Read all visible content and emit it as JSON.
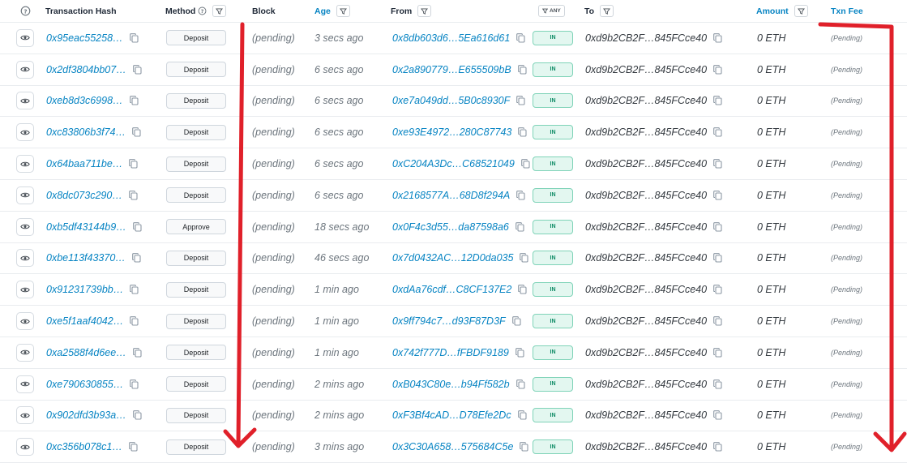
{
  "header": {
    "transaction_hash": "Transaction Hash",
    "method": "Method",
    "block": "Block",
    "age": "Age",
    "from": "From",
    "any": "ANY",
    "to": "To",
    "amount": "Amount",
    "txn_fee": "Txn Fee"
  },
  "rows": [
    {
      "hash": "0x95eac55258…",
      "method": "Deposit",
      "block": "(pending)",
      "age": "3 secs ago",
      "from": "0x8db603d6…5Ea616d61",
      "direction": "IN",
      "to": "0xd9b2CB2F…845FCce40",
      "amount": "0 ETH",
      "fee": "(Pending)"
    },
    {
      "hash": "0x2df3804bb07…",
      "method": "Deposit",
      "block": "(pending)",
      "age": "6 secs ago",
      "from": "0x2a890779…E655509bB",
      "direction": "IN",
      "to": "0xd9b2CB2F…845FCce40",
      "amount": "0 ETH",
      "fee": "(Pending)"
    },
    {
      "hash": "0xeb8d3c6998…",
      "method": "Deposit",
      "block": "(pending)",
      "age": "6 secs ago",
      "from": "0xe7a049dd…5B0c8930F",
      "direction": "IN",
      "to": "0xd9b2CB2F…845FCce40",
      "amount": "0 ETH",
      "fee": "(Pending)"
    },
    {
      "hash": "0xc83806b3f74…",
      "method": "Deposit",
      "block": "(pending)",
      "age": "6 secs ago",
      "from": "0xe93E4972…280C87743",
      "direction": "IN",
      "to": "0xd9b2CB2F…845FCce40",
      "amount": "0 ETH",
      "fee": "(Pending)"
    },
    {
      "hash": "0x64baa711be…",
      "method": "Deposit",
      "block": "(pending)",
      "age": "6 secs ago",
      "from": "0xC204A3Dc…C68521049",
      "direction": "IN",
      "to": "0xd9b2CB2F…845FCce40",
      "amount": "0 ETH",
      "fee": "(Pending)"
    },
    {
      "hash": "0x8dc073c290…",
      "method": "Deposit",
      "block": "(pending)",
      "age": "6 secs ago",
      "from": "0x2168577A…68D8f294A",
      "direction": "IN",
      "to": "0xd9b2CB2F…845FCce40",
      "amount": "0 ETH",
      "fee": "(Pending)"
    },
    {
      "hash": "0xb5df43144b9…",
      "method": "Approve",
      "block": "(pending)",
      "age": "18 secs ago",
      "from": "0x0F4c3d55…da87598a6",
      "direction": "IN",
      "to": "0xd9b2CB2F…845FCce40",
      "amount": "0 ETH",
      "fee": "(Pending)"
    },
    {
      "hash": "0xbe113f43370…",
      "method": "Deposit",
      "block": "(pending)",
      "age": "46 secs ago",
      "from": "0x7d0432AC…12D0da035",
      "direction": "IN",
      "to": "0xd9b2CB2F…845FCce40",
      "amount": "0 ETH",
      "fee": "(Pending)"
    },
    {
      "hash": "0x91231739bb…",
      "method": "Deposit",
      "block": "(pending)",
      "age": "1 min ago",
      "from": "0xdAa76cdf…C8CF137E2",
      "direction": "IN",
      "to": "0xd9b2CB2F…845FCce40",
      "amount": "0 ETH",
      "fee": "(Pending)"
    },
    {
      "hash": "0xe5f1aaf4042…",
      "method": "Deposit",
      "block": "(pending)",
      "age": "1 min ago",
      "from": "0x9ff794c7…d93F87D3F",
      "direction": "IN",
      "to": "0xd9b2CB2F…845FCce40",
      "amount": "0 ETH",
      "fee": "(Pending)"
    },
    {
      "hash": "0xa2588f4d6ee…",
      "method": "Deposit",
      "block": "(pending)",
      "age": "1 min ago",
      "from": "0x742f777D…fFBDF9189",
      "direction": "IN",
      "to": "0xd9b2CB2F…845FCce40",
      "amount": "0 ETH",
      "fee": "(Pending)"
    },
    {
      "hash": "0xe790630855…",
      "method": "Deposit",
      "block": "(pending)",
      "age": "2 mins ago",
      "from": "0xB043C80e…b94Ff582b",
      "direction": "IN",
      "to": "0xd9b2CB2F…845FCce40",
      "amount": "0 ETH",
      "fee": "(Pending)"
    },
    {
      "hash": "0x902dfd3b93a…",
      "method": "Deposit",
      "block": "(pending)",
      "age": "2 mins ago",
      "from": "0xF3Bf4cAD…D78Efe2Dc",
      "direction": "IN",
      "to": "0xd9b2CB2F…845FCce40",
      "amount": "0 ETH",
      "fee": "(Pending)"
    },
    {
      "hash": "0xc356b078c1…",
      "method": "Deposit",
      "block": "(pending)",
      "age": "3 mins ago",
      "from": "0x3C30A658…575684C5e",
      "direction": "IN",
      "to": "0xd9b2CB2F…845FCce40",
      "amount": "0 ETH",
      "fee": "(Pending)"
    }
  ],
  "colors": {
    "link": "#0784c3",
    "in_badge_bg": "#e3f7f0",
    "in_badge_text": "#0b8a63",
    "annotation_red": "#e0202a"
  }
}
